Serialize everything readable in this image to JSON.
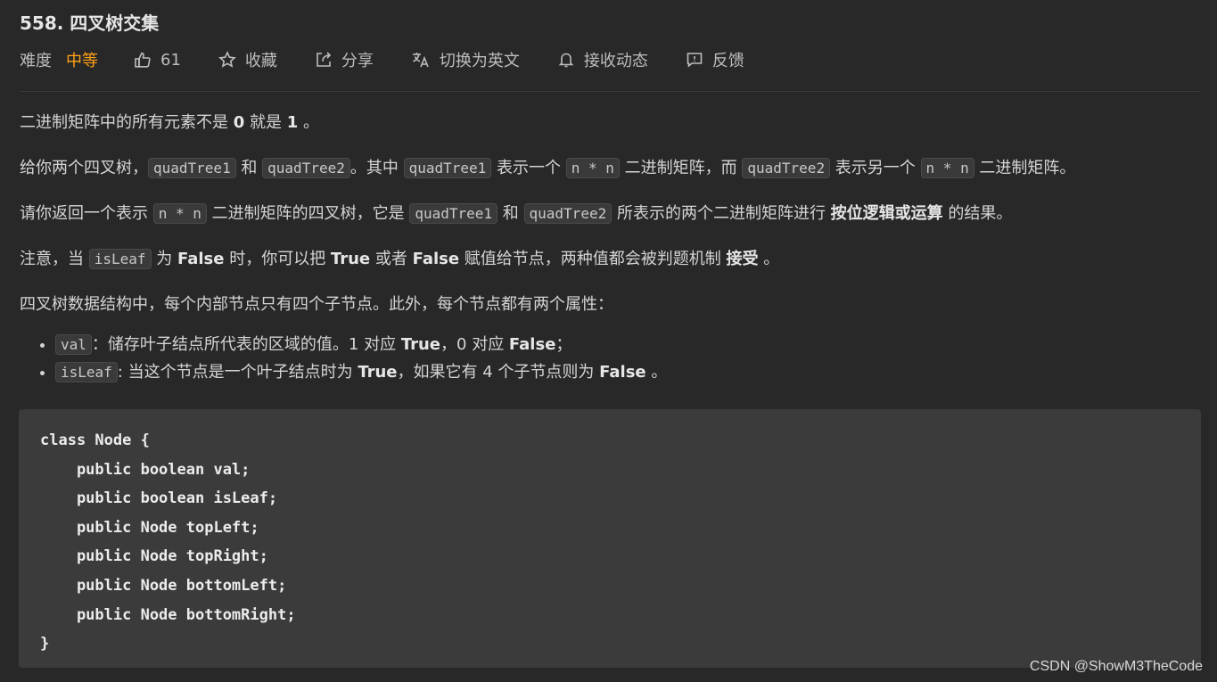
{
  "problem": {
    "title": "558. 四叉树交集",
    "difficulty_label": "难度",
    "difficulty": "中等",
    "likes": "61",
    "favorite_label": "收藏",
    "share_label": "分享",
    "switch_lang_label": "切换为英文",
    "notify_label": "接收动态",
    "feedback_label": "反馈"
  },
  "description": {
    "p1": {
      "a": "二进制矩阵中的所有元素不是 ",
      "b": "0",
      "c": " 就是 ",
      "d": "1",
      "e": " 。"
    },
    "p2": {
      "a": "给你两个四叉树，",
      "code1": "quadTree1",
      "b": " 和 ",
      "code2": "quadTree2",
      "c": "。其中 ",
      "code3": "quadTree1",
      "d": " 表示一个 ",
      "code4": "n * n",
      "e": " 二进制矩阵，而 ",
      "code5": "quadTree2",
      "f": " 表示另一个 ",
      "code6": "n * n",
      "g": " 二进制矩阵。"
    },
    "p3": {
      "a": "请你返回一个表示 ",
      "code1": "n * n",
      "b": " 二进制矩阵的四叉树，它是 ",
      "code2": "quadTree1",
      "c": " 和 ",
      "code3": "quadTree2",
      "d": " 所表示的两个二进制矩阵进行 ",
      "bold": "按位逻辑或运算",
      "e": " 的结果。"
    },
    "p4": {
      "a": "注意，当 ",
      "code1": "isLeaf",
      "b": " 为 ",
      "bold1": "False",
      "c": " 时，你可以把 ",
      "bold2": "True",
      "d": " 或者 ",
      "bold3": "False",
      "e": " 赋值给节点，两种值都会被判题机制 ",
      "bold4": "接受",
      "f": " 。"
    },
    "p5": "四叉树数据结构中，每个内部节点只有四个子节点。此外，每个节点都有两个属性：",
    "bullets": [
      {
        "code": "val",
        "a": "：储存叶子结点所代表的区域的值。1 对应 ",
        "bold1": "True",
        "b": "，0 对应 ",
        "bold2": "False",
        "c": "；"
      },
      {
        "code": "isLeaf",
        "a": ": 当这个节点是一个叶子结点时为 ",
        "bold1": "True",
        "b": "，如果它有 4 个子节点则为 ",
        "bold2": "False",
        "c": " 。"
      }
    ],
    "codeblock": "class Node {\n    public boolean val;\n    public boolean isLeaf;\n    public Node topLeft;\n    public Node topRight;\n    public Node bottomLeft;\n    public Node bottomRight;\n}"
  },
  "watermark": "CSDN @ShowM3TheCode",
  "colors": {
    "background": "#282828",
    "difficulty": "#ffa116",
    "code_bg": "#3b3b3b"
  }
}
